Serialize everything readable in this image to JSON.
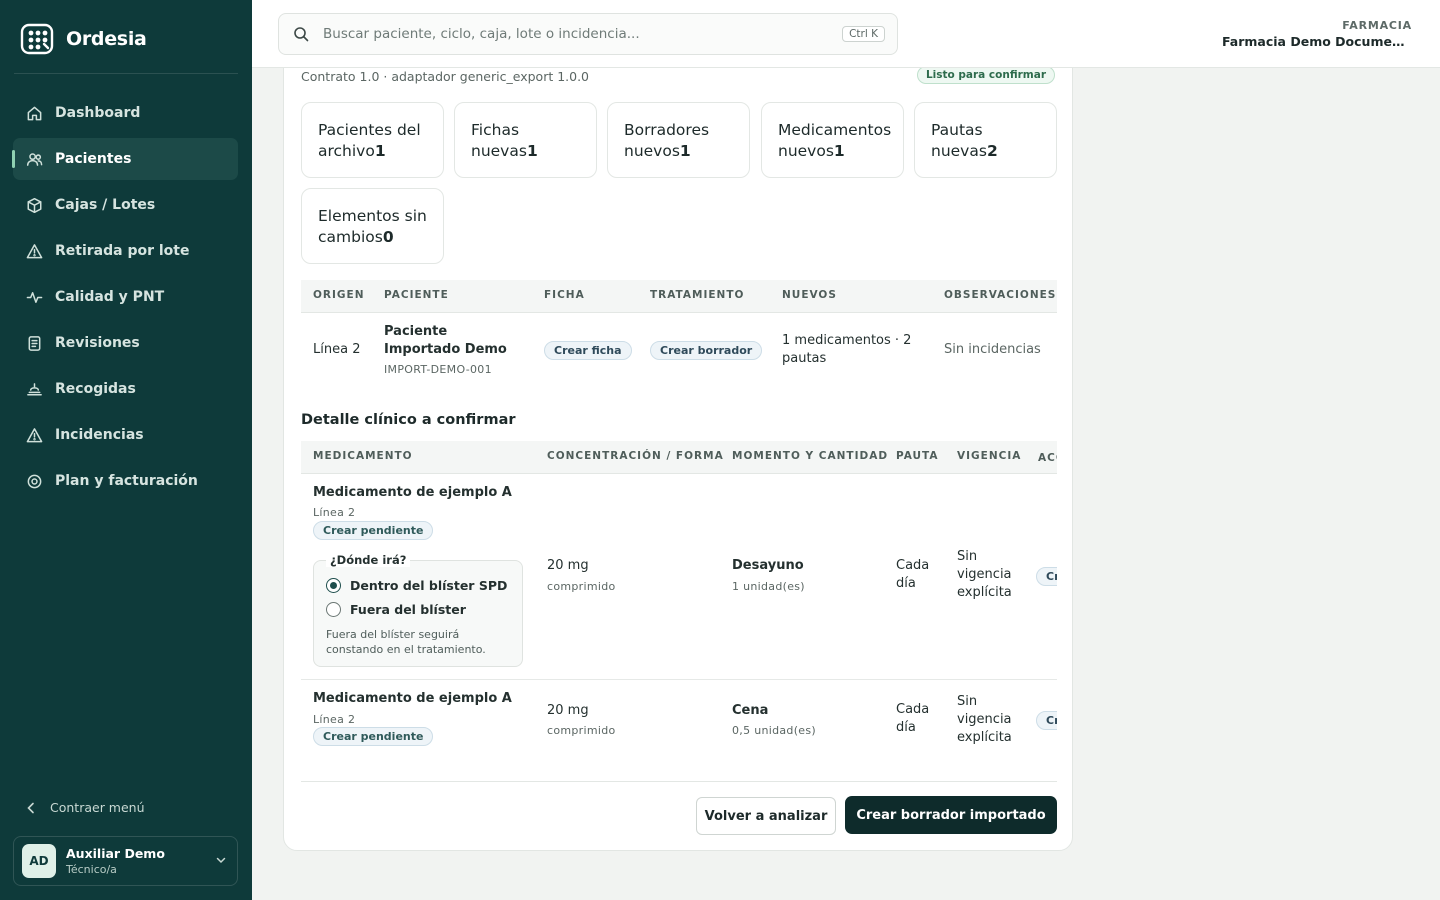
{
  "app": {
    "name": "Ordesia"
  },
  "sidebar": {
    "items": [
      {
        "label": "Dashboard",
        "icon": "home-icon"
      },
      {
        "label": "Pacientes",
        "icon": "users-icon",
        "active": true
      },
      {
        "label": "Cajas / Lotes",
        "icon": "box-icon"
      },
      {
        "label": "Retirada por lote",
        "icon": "warning-icon"
      },
      {
        "label": "Calidad y PNT",
        "icon": "activity-icon"
      },
      {
        "label": "Revisiones",
        "icon": "document-icon"
      },
      {
        "label": "Recogidas",
        "icon": "pickup-icon"
      },
      {
        "label": "Incidencias",
        "icon": "warning-icon"
      },
      {
        "label": "Plan y facturación",
        "icon": "settings-icon"
      }
    ],
    "collapse_label": "Contraer menú",
    "user": {
      "initials": "AD",
      "name": "Auxiliar Demo",
      "role": "Técnico/a"
    }
  },
  "topbar": {
    "search_placeholder": "Buscar paciente, ciclo, caja, lote o incidencia...",
    "shortcut": "Ctrl K",
    "pharmacy_label": "FARMACIA",
    "pharmacy_name": "Farmacia Demo Documen..."
  },
  "import": {
    "contract": "Contrato 1.0 · adaptador generic_export 1.0.0",
    "status_badge": "Listo para confirmar",
    "stats": [
      {
        "label": "Pacientes del archivo",
        "value": "1"
      },
      {
        "label": "Fichas nuevas",
        "value": "1"
      },
      {
        "label": "Borradores nuevos",
        "value": "1"
      },
      {
        "label": "Medicamentos nuevos",
        "value": "1"
      },
      {
        "label": "Pautas nuevas",
        "value": "2"
      },
      {
        "label": "Elementos sin cambios",
        "value": "0"
      }
    ],
    "patients_table": {
      "headers": [
        "ORIGEN",
        "PACIENTE",
        "FICHA",
        "TRATAMIENTO",
        "NUEVOS",
        "OBSERVACIONES"
      ],
      "rows": [
        {
          "origin": "Línea 2",
          "patient_name": "Paciente Importado Demo",
          "patient_id": "IMPORT-DEMO-001",
          "record_action": "Crear ficha",
          "treatment_action": "Crear borrador",
          "new_items": "1 medicamentos · 2 pautas",
          "observations": "Sin incidencias"
        }
      ]
    },
    "clinical_title": "Detalle clínico a confirmar",
    "clinical_table": {
      "headers": [
        "MEDICAMENTO",
        "CONCENTRACIÓN / FORMA",
        "MOMENTO Y CANTIDAD",
        "PAUTA",
        "VIGENCIA",
        "ACCIÓN"
      ],
      "rows": [
        {
          "medication": "Medicamento de ejemplo A",
          "line": "Línea 2",
          "status": "Crear pendiente",
          "strength": "20 mg",
          "form": "comprimido",
          "moment": "Desayuno",
          "quantity": "1 unidad(es)",
          "schedule": "Cada día",
          "validity": "Sin vigencia explícita",
          "action": "Crear"
        },
        {
          "medication": "Medicamento de ejemplo A",
          "line": "Línea 2",
          "status": "Crear pendiente",
          "strength": "20 mg",
          "form": "comprimido",
          "moment": "Cena",
          "quantity": "0,5 unidad(es)",
          "schedule": "Cada día",
          "validity": "Sin vigencia explícita",
          "action": "Crear"
        }
      ]
    },
    "placement": {
      "legend": "¿Dónde irá?",
      "options": [
        "Dentro del blíster SPD",
        "Fuera del blíster"
      ],
      "selected": "Dentro del blíster SPD",
      "note": "Fuera del blíster seguirá constando en el tratamiento."
    },
    "actions": {
      "secondary": "Volver a analizar",
      "primary": "Crear borrador importado"
    }
  },
  "colors": {
    "sidebar_bg": "#0e3a3a",
    "primary_button": "#0e2b2b",
    "accent": "#8fd1b2"
  }
}
